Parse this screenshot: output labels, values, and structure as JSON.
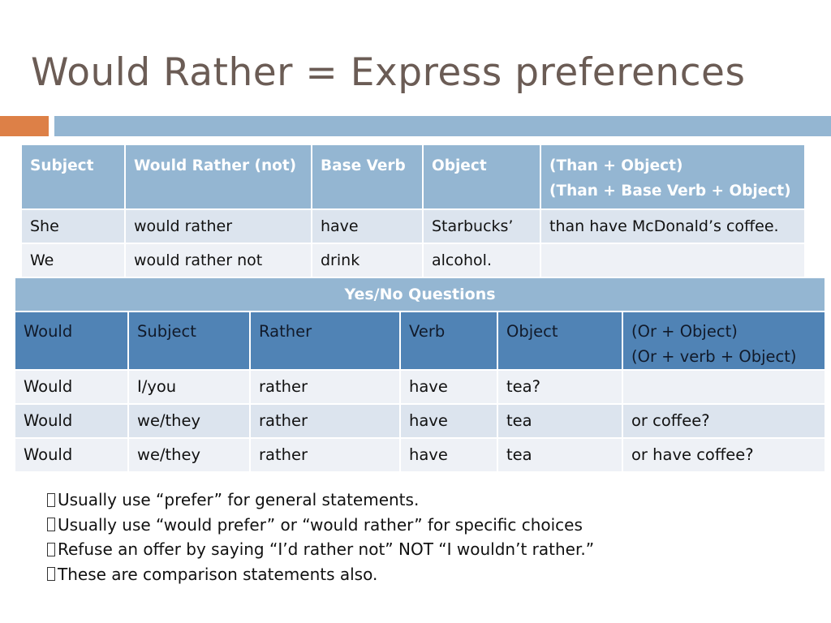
{
  "slide": {
    "title": "Would Rather = Express preferences",
    "colors": {
      "accent_orange": "#dd8047",
      "accent_blue": "#94b6d2",
      "header_dark_blue": "#5083b5",
      "row_light": "#eef1f6",
      "row_mid": "#dce4ee",
      "title_color": "#6b5c55"
    }
  },
  "statement_table": {
    "headers": [
      "Subject",
      "Would Rather (not)",
      "Base Verb",
      "Object",
      "(Than + Object)",
      "(Than + Base Verb + Object)"
    ],
    "rows": [
      [
        "She",
        "would rather",
        "have",
        "Starbucks’",
        "than have McDonald’s coffee."
      ],
      [
        "We",
        "would rather not",
        "drink",
        "alcohol.",
        ""
      ]
    ]
  },
  "question_table": {
    "banner": "Yes/No Questions",
    "headers": [
      "Would",
      "Subject",
      "Rather",
      "Verb",
      "Object",
      "(Or + Object)",
      "(Or + verb + Object)"
    ],
    "rows": [
      [
        "Would",
        "I/you",
        "rather",
        "have",
        "tea?",
        ""
      ],
      [
        "Would",
        "we/they",
        "rather",
        "have",
        "tea",
        "or coffee?"
      ],
      [
        "Would",
        "we/they",
        "rather",
        "have",
        "tea",
        "or have coffee?"
      ]
    ]
  },
  "notes": [
    {
      "bullet_icon": "missing-glyph-box",
      "text": "Usually use “prefer” for general statements."
    },
    {
      "bullet_icon": "missing-glyph-box",
      "text": "Usually use “would prefer” or “would rather” for specific choices"
    },
    {
      "bullet_icon": "missing-glyph-box",
      "text": "Refuse an offer by saying “I’d rather not” NOT “I wouldn’t rather.”"
    },
    {
      "bullet_icon": "missing-glyph-box",
      "text": "These are comparison statements also."
    }
  ]
}
